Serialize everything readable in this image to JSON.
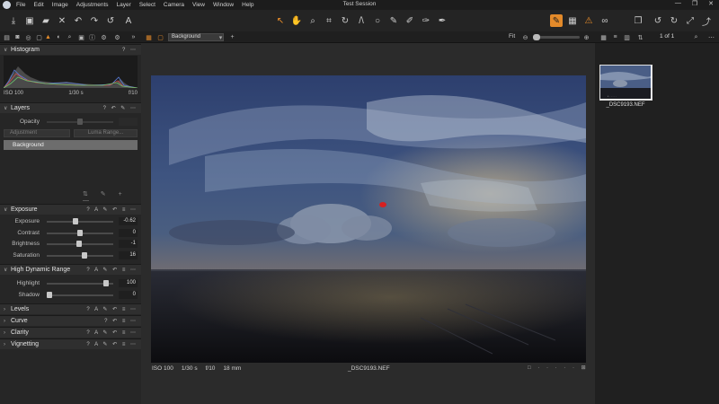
{
  "app": {
    "title": "Test Session"
  },
  "menu": [
    "File",
    "Edit",
    "Image",
    "Adjustments",
    "Layer",
    "Select",
    "Camera",
    "View",
    "Window",
    "Help"
  ],
  "window_controls": [
    "—",
    "❐",
    "✕"
  ],
  "layer_select": {
    "value": "Background"
  },
  "zoom": {
    "label": "Fit",
    "fraction": 0.0
  },
  "browser": {
    "page": "1 of 1"
  },
  "histogram": {
    "title": "Histogram",
    "iso": "ISO 100",
    "shutter": "1/30 s",
    "aperture": "f/10"
  },
  "layers": {
    "title": "Layers",
    "opacity_label": "Opacity",
    "adjustment_label": "Adjustment",
    "luma_label": "Luma Range...",
    "background_layer": "Background"
  },
  "exposure": {
    "title": "Exposure",
    "rows": [
      {
        "label": "Exposure",
        "value": "-0.62",
        "pos": 0.42
      },
      {
        "label": "Contrast",
        "value": "0",
        "pos": 0.5
      },
      {
        "label": "Brightness",
        "value": "-1",
        "pos": 0.48
      },
      {
        "label": "Saturation",
        "value": "16",
        "pos": 0.57
      }
    ]
  },
  "hdr": {
    "title": "High Dynamic Range",
    "rows": [
      {
        "label": "Highlight",
        "value": "100",
        "pos": 0.92
      },
      {
        "label": "Shadow",
        "value": "0",
        "pos": 0.0
      }
    ]
  },
  "collapsed_sections": [
    "Levels",
    "Curve",
    "Clarity",
    "Vignetting"
  ],
  "viewer": {
    "iso": "ISO 100",
    "shutter": "1/30 s",
    "aperture": "f/10",
    "focal": "18 mm",
    "filename": "_DSC9193.NEF"
  },
  "thumbnail": {
    "filename": "_DSC9193.NEF"
  },
  "colors": {
    "accent": "#e38a2a",
    "warning": "#f0902a"
  }
}
